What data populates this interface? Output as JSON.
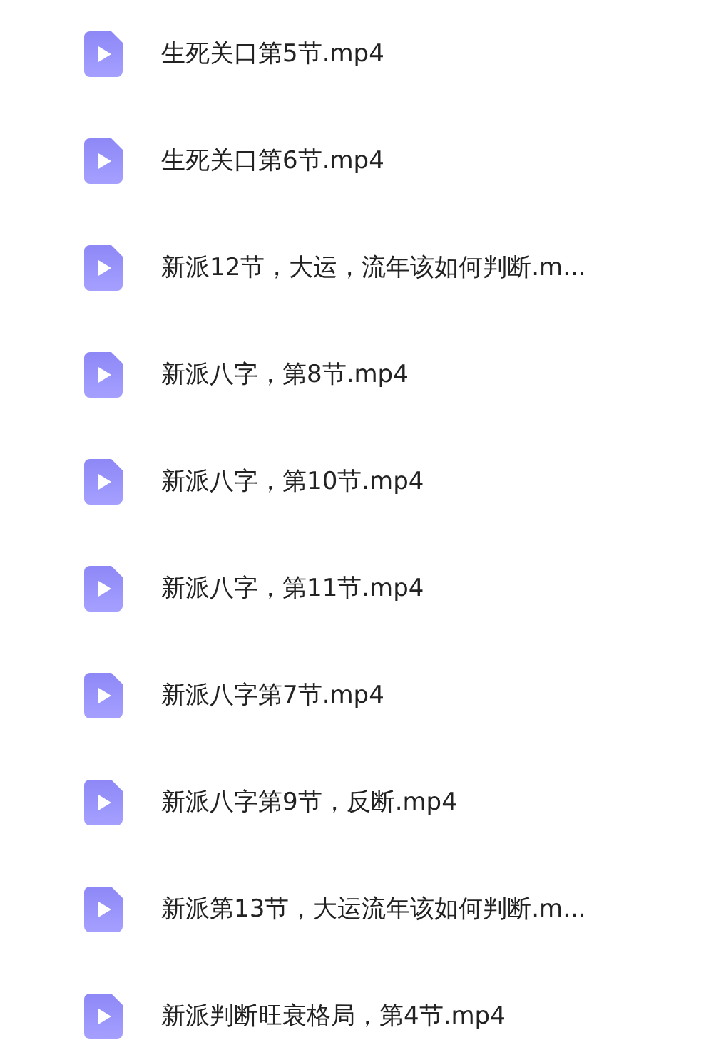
{
  "files": [
    {
      "name": "生死关口第5节.mp4"
    },
    {
      "name": "生死关口第6节.mp4"
    },
    {
      "name": "新派12节，大运，流年该如何判断.m..."
    },
    {
      "name": "新派八字，第8节.mp4"
    },
    {
      "name": "新派八字，第10节.mp4"
    },
    {
      "name": "新派八字，第11节.mp4"
    },
    {
      "name": "新派八字第7节.mp4"
    },
    {
      "name": "新派八字第9节，反断.mp4"
    },
    {
      "name": "新派第13节，大运流年该如何判断.m..."
    },
    {
      "name": "新派判断旺衰格局，第4节.mp4"
    }
  ]
}
